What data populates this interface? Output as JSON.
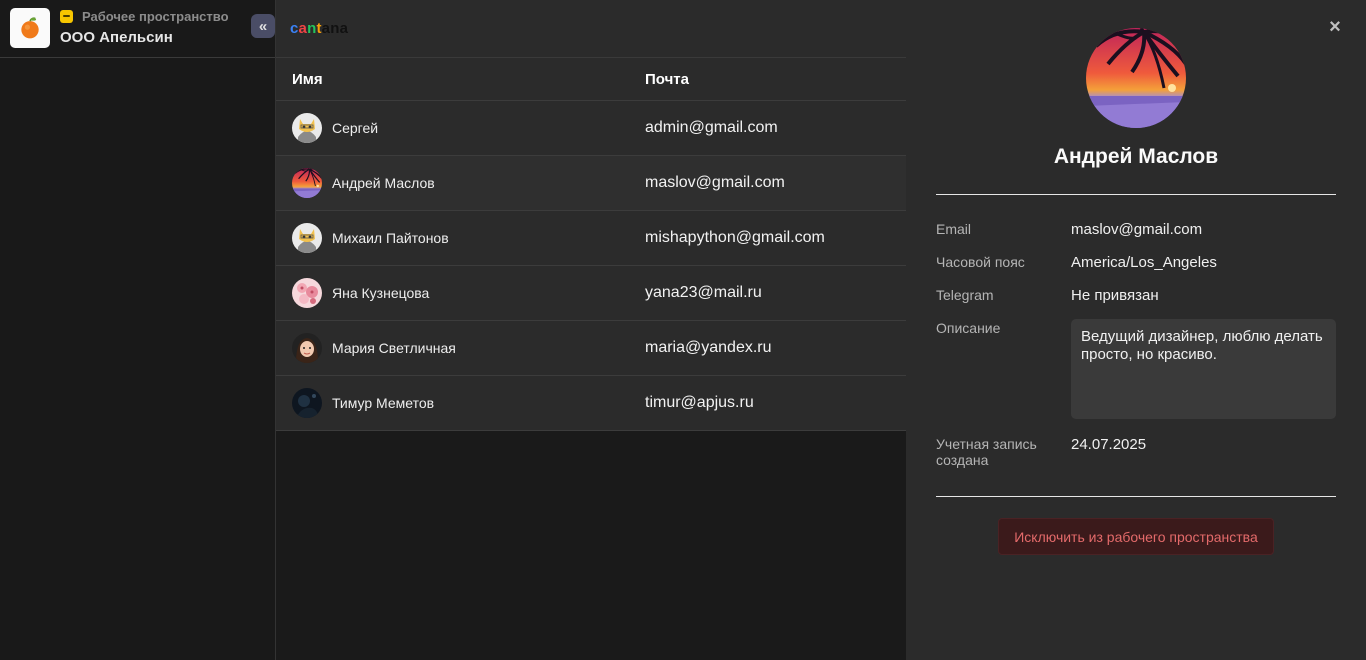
{
  "workspace": {
    "kind": "Рабочее пространство",
    "name": "ООО Апельсин",
    "collapse_glyph": "«"
  },
  "brand": {
    "parts": [
      "c",
      "a",
      "n",
      "t",
      "ana"
    ]
  },
  "table": {
    "columns": {
      "name": "Имя",
      "email": "Почта"
    },
    "rows": [
      {
        "name": "Сергей",
        "email": "admin@gmail.com",
        "avatar": "cat-avatar"
      },
      {
        "name": "Андрей Маслов",
        "email": "maslov@gmail.com",
        "avatar": "sunset-avatar"
      },
      {
        "name": "Михаил Пайтонов",
        "email": "mishapython@gmail.com",
        "avatar": "cat-avatar"
      },
      {
        "name": "Яна Кузнецова",
        "email": "yana23@mail.ru",
        "avatar": "blossom-avatar"
      },
      {
        "name": "Мария Светличная",
        "email": "maria@yandex.ru",
        "avatar": "girl-avatar"
      },
      {
        "name": "Тимур Меметов",
        "email": "timur@apjus.ru",
        "avatar": "night-avatar"
      }
    ]
  },
  "profile": {
    "close_glyph": "×",
    "name": "Андрей Маслов",
    "email_label": "Email",
    "email_value": "maslov@gmail.com",
    "timezone_label": "Часовой пояс",
    "timezone_value": "America/Los_Angeles",
    "telegram_label": "Telegram",
    "telegram_value": "Не привязан",
    "description_label": "Описание",
    "description_value": "Ведущий дизайнер, люблю делать просто, но красиво.",
    "created_label": "Учетная запись создана",
    "created_value": "24.07.2025",
    "kick_button": "Исключить из рабочего пространства"
  },
  "colors": {
    "accent_badge": "#f7c600",
    "danger_text": "#e36a6a",
    "panel_bg": "#2b2b2b"
  }
}
